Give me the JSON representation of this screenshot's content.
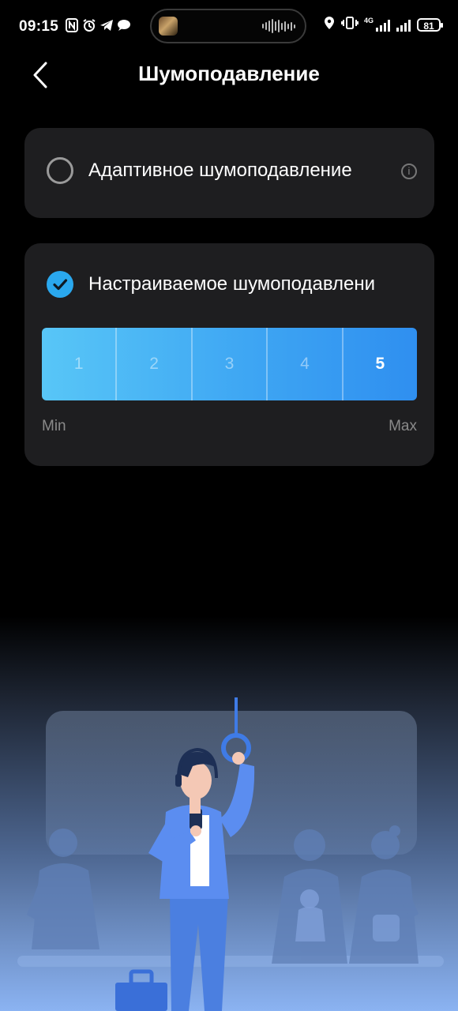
{
  "status_bar": {
    "time": "09:15",
    "left_icons": [
      "nfc-icon",
      "alarm-icon",
      "telegram-icon",
      "chat-bubble-icon"
    ],
    "right_icons": [
      "location-icon",
      "vibrate-icon",
      "signal-4g-icon",
      "signal-icon"
    ],
    "network_label": "4G",
    "battery": "81"
  },
  "header": {
    "back_icon": "chevron-left-icon",
    "title": "Шумоподавление"
  },
  "options": {
    "adaptive": {
      "label": "Адаптивное шумоподавление",
      "selected": false,
      "info_icon": "info-icon",
      "info_glyph": "i"
    },
    "custom": {
      "label": "Настраиваемое шумоподавлени",
      "selected": true,
      "levels": [
        "1",
        "2",
        "3",
        "4",
        "5"
      ],
      "active_level": "5",
      "min_label": "Min",
      "max_label": "Max"
    }
  },
  "colors": {
    "accent": "#2aa8ee",
    "card": "#1e1e20",
    "background": "#000000"
  }
}
